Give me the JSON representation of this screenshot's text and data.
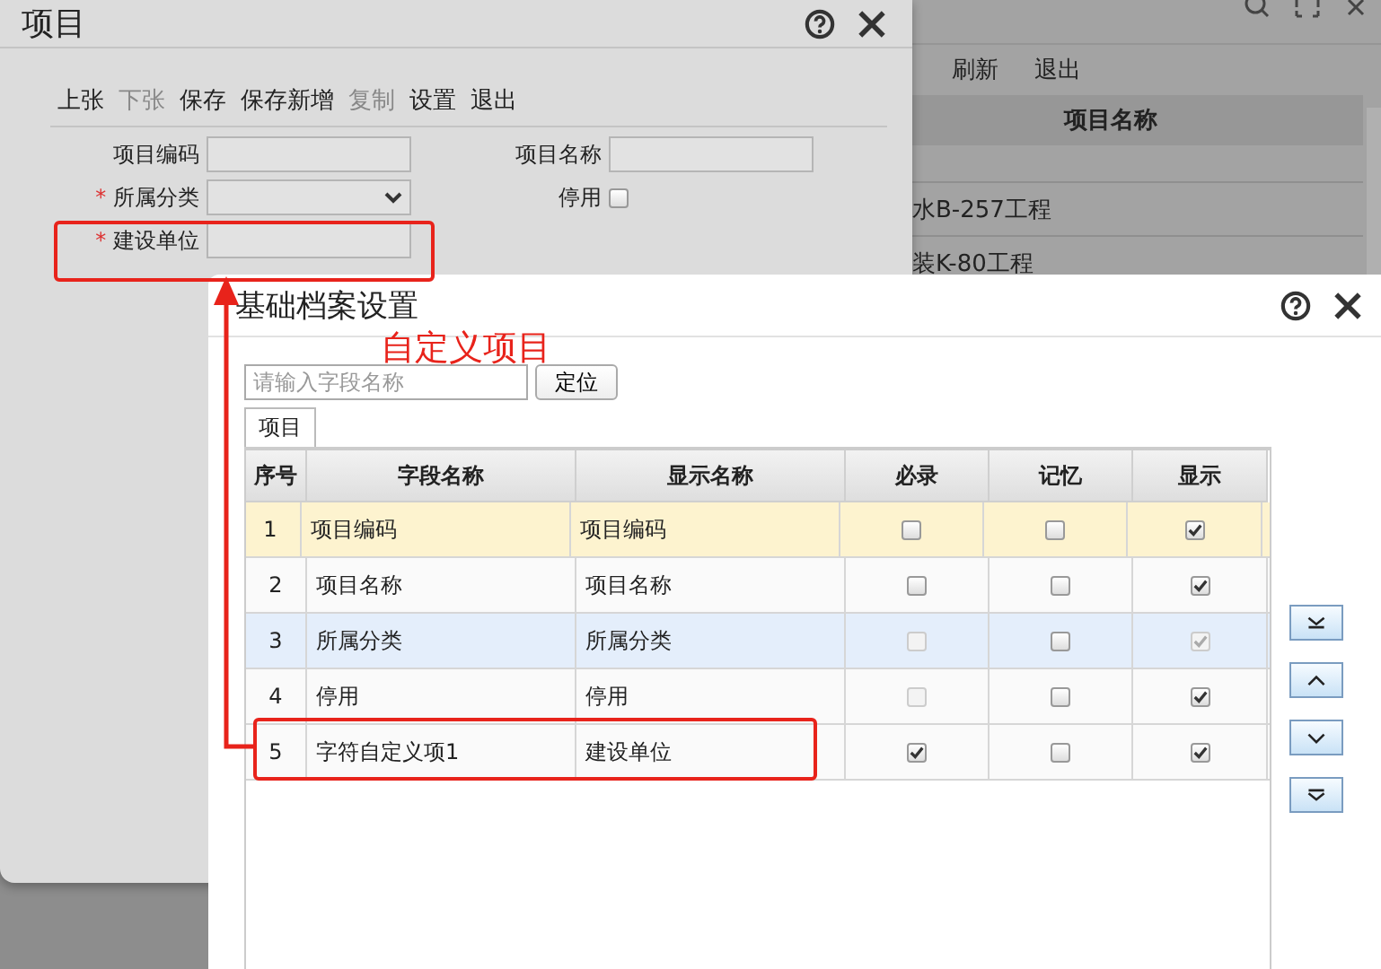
{
  "background": {
    "toolbar": [
      "刷新",
      "退出"
    ],
    "table_header": "项目名称",
    "rows": [
      "水B-257工程",
      "装K-80工程"
    ]
  },
  "project_dialog": {
    "title": "项目",
    "required_marker": "*",
    "toolbar": [
      {
        "label": "上张",
        "disabled": false
      },
      {
        "label": "下张",
        "disabled": true
      },
      {
        "label": "保存",
        "disabled": false
      },
      {
        "label": "保存新增",
        "disabled": false
      },
      {
        "label": "复制",
        "disabled": true
      },
      {
        "label": "设置",
        "disabled": false
      },
      {
        "label": "退出",
        "disabled": false
      }
    ],
    "fields": [
      {
        "label": "项目编码",
        "kind": "text",
        "required": false
      },
      {
        "label": "项目名称",
        "kind": "text",
        "required": false
      },
      {
        "label": "所属分类",
        "kind": "select",
        "required": true
      },
      {
        "label": "停用",
        "kind": "checkbox",
        "required": false,
        "checked": false
      },
      {
        "label": "建设单位",
        "kind": "text",
        "required": true
      }
    ]
  },
  "settings_dialog": {
    "title": "基础档案设置",
    "search": {
      "placeholder": "请输入字段名称"
    },
    "locate_button": "定位",
    "tabs": [
      {
        "label": "项目",
        "selected": true
      }
    ],
    "columns": [
      "序号",
      "字段名称",
      "显示名称",
      "必录",
      "记忆",
      "显示"
    ],
    "rows": [
      {
        "no": "1",
        "field": "项目编码",
        "display": "项目编码",
        "selected": true,
        "hovered": false,
        "required": {
          "checked": false,
          "disabled": false
        },
        "remember": {
          "checked": false,
          "disabled": false
        },
        "show": {
          "checked": true,
          "disabled": false
        }
      },
      {
        "no": "2",
        "field": "项目名称",
        "display": "项目名称",
        "selected": false,
        "hovered": false,
        "required": {
          "checked": false,
          "disabled": false
        },
        "remember": {
          "checked": false,
          "disabled": false
        },
        "show": {
          "checked": true,
          "disabled": false
        }
      },
      {
        "no": "3",
        "field": "所属分类",
        "display": "所属分类",
        "selected": false,
        "hovered": true,
        "required": {
          "checked": false,
          "disabled": true
        },
        "remember": {
          "checked": false,
          "disabled": false
        },
        "show": {
          "checked": true,
          "disabled": true
        }
      },
      {
        "no": "4",
        "field": "停用",
        "display": "停用",
        "selected": false,
        "hovered": false,
        "required": {
          "checked": false,
          "disabled": true
        },
        "remember": {
          "checked": false,
          "disabled": false
        },
        "show": {
          "checked": true,
          "disabled": false
        }
      },
      {
        "no": "5",
        "field": "字符自定义项1",
        "display": "建设单位",
        "selected": false,
        "hovered": false,
        "required": {
          "checked": true,
          "disabled": false
        },
        "remember": {
          "checked": false,
          "disabled": false
        },
        "show": {
          "checked": true,
          "disabled": false
        }
      }
    ]
  },
  "annotation": {
    "label": "自定义项目"
  }
}
